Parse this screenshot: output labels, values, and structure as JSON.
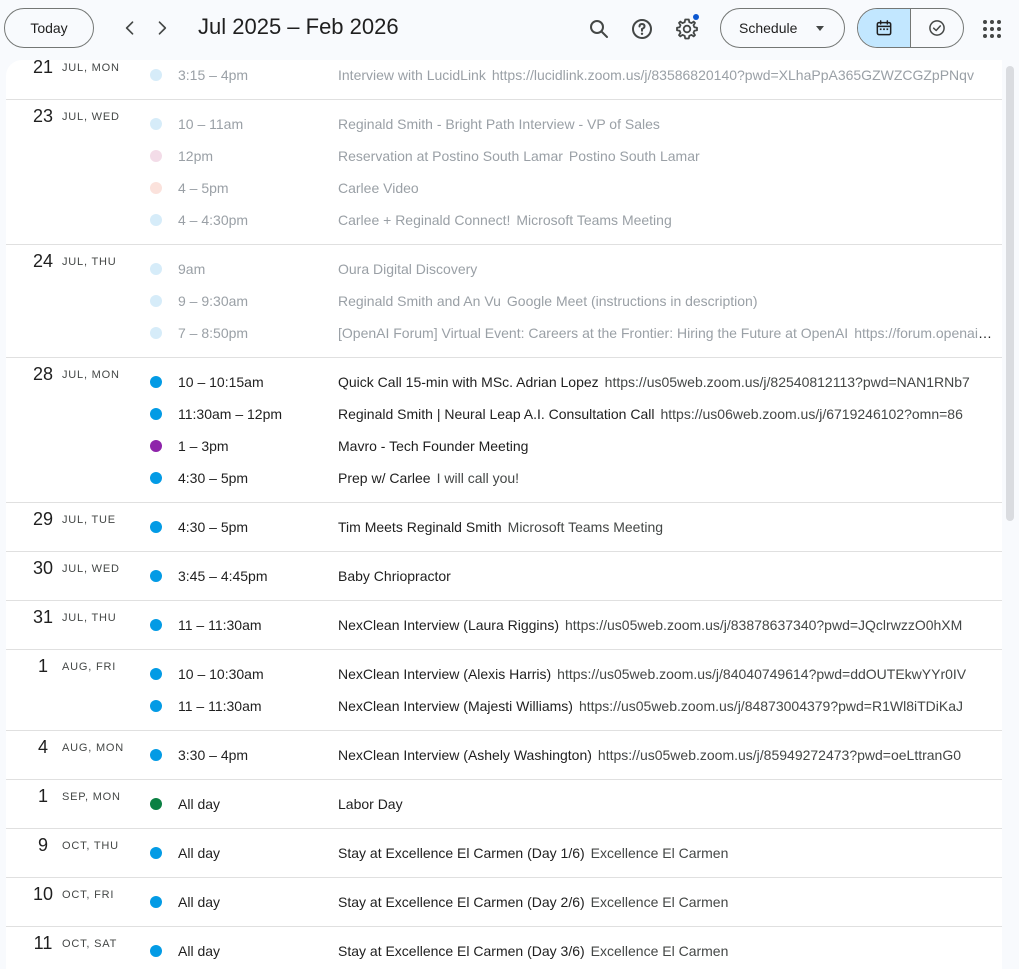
{
  "header": {
    "today_label": "Today",
    "date_range": "Jul 2025 – Feb 2026",
    "view_label": "Schedule",
    "icons": [
      "chevron-left-icon",
      "chevron-right-icon",
      "search-icon",
      "help-icon",
      "gear-icon",
      "calendar-icon",
      "tasks-icon",
      "apps-grid-icon"
    ]
  },
  "colors": {
    "blue": "#039be5",
    "purple": "#8e24aa",
    "green": "#0b8043",
    "past_blue": "#d6ecf9",
    "past_pink": "#f3dce8",
    "past_peach": "#fbe2dc"
  },
  "days": [
    {
      "num": "21",
      "label": "Jul, Mon",
      "past": true,
      "events": [
        {
          "time": "3:15 – 4pm",
          "title": "Interview with LucidLink",
          "sub": "https://lucidlink.zoom.us/j/83586820140?pwd=XLhaPpA365GZWZCGZpPNqv",
          "color": "#d6ecf9"
        }
      ]
    },
    {
      "num": "23",
      "label": "Jul, Wed",
      "past": true,
      "events": [
        {
          "time": "10 – 11am",
          "title": "Reginald Smith - Bright Path Interview - VP of Sales",
          "sub": "",
          "color": "#d6ecf9"
        },
        {
          "time": "12pm",
          "title": "Reservation at Postino South Lamar",
          "sub": "Postino South Lamar",
          "color": "#f3dce8"
        },
        {
          "time": "4 – 5pm",
          "title": "Carlee Video",
          "sub": "",
          "color": "#fbe2dc"
        },
        {
          "time": "4 – 4:30pm",
          "title": "Carlee + Reginald Connect!",
          "sub": "Microsoft Teams Meeting",
          "color": "#d6ecf9"
        }
      ]
    },
    {
      "num": "24",
      "label": "Jul, Thu",
      "past": true,
      "events": [
        {
          "time": "9am",
          "title": "Oura Digital Discovery",
          "sub": "",
          "color": "#d6ecf9"
        },
        {
          "time": "9 – 9:30am",
          "title": "Reginald Smith and An Vu",
          "sub": "Google Meet (instructions in description)",
          "color": "#d6ecf9"
        },
        {
          "time": "7 – 8:50pm",
          "title": "[OpenAI Forum] Virtual Event: Careers at the Frontier: Hiring the Future at OpenAI",
          "sub": "https://forum.openai.com",
          "color": "#d6ecf9"
        }
      ]
    },
    {
      "num": "28",
      "label": "Jul, Mon",
      "past": false,
      "events": [
        {
          "time": "10 – 10:15am",
          "title": "Quick Call 15-min with MSc. Adrian Lopez",
          "sub": "https://us05web.zoom.us/j/82540812113?pwd=NAN1RNb7",
          "color": "#039be5"
        },
        {
          "time": "11:30am – 12pm",
          "title": "Reginald Smith | Neural Leap A.I. Consultation Call",
          "sub": "https://us06web.zoom.us/j/6719246102?omn=86",
          "color": "#039be5"
        },
        {
          "time": "1 – 3pm",
          "title": "Mavro - Tech Founder Meeting",
          "sub": "",
          "color": "#8e24aa"
        },
        {
          "time": "4:30 – 5pm",
          "title": "Prep w/ Carlee",
          "sub": "I will call you!",
          "color": "#039be5"
        }
      ]
    },
    {
      "num": "29",
      "label": "Jul, Tue",
      "past": false,
      "events": [
        {
          "time": "4:30 – 5pm",
          "title": "Tim Meets Reginald Smith",
          "sub": "Microsoft Teams Meeting",
          "color": "#039be5"
        }
      ]
    },
    {
      "num": "30",
      "label": "Jul, Wed",
      "past": false,
      "events": [
        {
          "time": "3:45 – 4:45pm",
          "title": "Baby Chriopractor",
          "sub": "",
          "color": "#039be5"
        }
      ]
    },
    {
      "num": "31",
      "label": "Jul, Thu",
      "past": false,
      "events": [
        {
          "time": "11 – 11:30am",
          "title": "NexClean Interview (Laura Riggins)",
          "sub": "https://us05web.zoom.us/j/83878637340?pwd=JQclrwzzO0hXM",
          "color": "#039be5"
        }
      ]
    },
    {
      "num": "1",
      "label": "Aug, Fri",
      "past": false,
      "events": [
        {
          "time": "10 – 10:30am",
          "title": "NexClean Interview (Alexis Harris)",
          "sub": "https://us05web.zoom.us/j/84040749614?pwd=ddOUTEkwYYr0IV",
          "color": "#039be5"
        },
        {
          "time": "11 – 11:30am",
          "title": "NexClean Interview (Majesti Williams)",
          "sub": "https://us05web.zoom.us/j/84873004379?pwd=R1Wl8iTDiKaJ",
          "color": "#039be5"
        }
      ]
    },
    {
      "num": "4",
      "label": "Aug, Mon",
      "past": false,
      "events": [
        {
          "time": "3:30 – 4pm",
          "title": "NexClean Interview (Ashely Washington)",
          "sub": "https://us05web.zoom.us/j/85949272473?pwd=oeLttranG0",
          "color": "#039be5"
        }
      ]
    },
    {
      "num": "1",
      "label": "Sep, Mon",
      "past": false,
      "events": [
        {
          "time": "All day",
          "title": "Labor Day",
          "sub": "",
          "color": "#0b8043"
        }
      ]
    },
    {
      "num": "9",
      "label": "Oct, Thu",
      "past": false,
      "events": [
        {
          "time": "All day",
          "title": "Stay at Excellence El Carmen (Day 1/6)",
          "sub": "Excellence El Carmen",
          "color": "#039be5"
        }
      ]
    },
    {
      "num": "10",
      "label": "Oct, Fri",
      "past": false,
      "events": [
        {
          "time": "All day",
          "title": "Stay at Excellence El Carmen (Day 2/6)",
          "sub": "Excellence El Carmen",
          "color": "#039be5"
        }
      ]
    },
    {
      "num": "11",
      "label": "Oct, Sat",
      "past": false,
      "events": [
        {
          "time": "All day",
          "title": "Stay at Excellence El Carmen (Day 3/6)",
          "sub": "Excellence El Carmen",
          "color": "#039be5"
        }
      ]
    }
  ]
}
